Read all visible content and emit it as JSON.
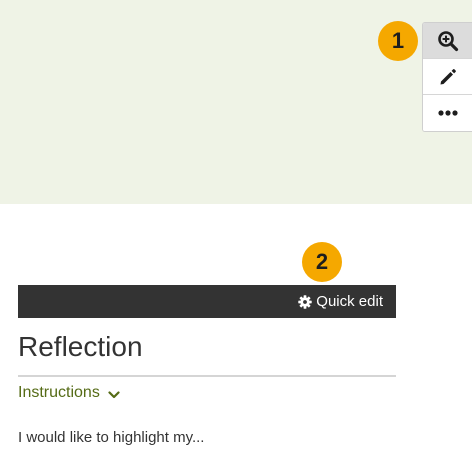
{
  "toolbar": {
    "buttons": [
      {
        "icon": "zoom-in-icon",
        "active": true
      },
      {
        "icon": "pencil-icon",
        "active": false
      },
      {
        "icon": "more-icon",
        "active": false
      }
    ]
  },
  "callouts": {
    "first": "1",
    "second": "2"
  },
  "block": {
    "quick_edit_label": "Quick edit",
    "quick_edit_icon": "gear-icon",
    "title": "Reflection",
    "instructions_label": "Instructions",
    "instructions_icon": "chevron-down-icon",
    "body_text": "I would like to highlight my..."
  },
  "colors": {
    "panel_background": "#eff3e6",
    "callout": "#f5a800",
    "header_bar": "#333333",
    "instructions_link": "#556b16"
  }
}
